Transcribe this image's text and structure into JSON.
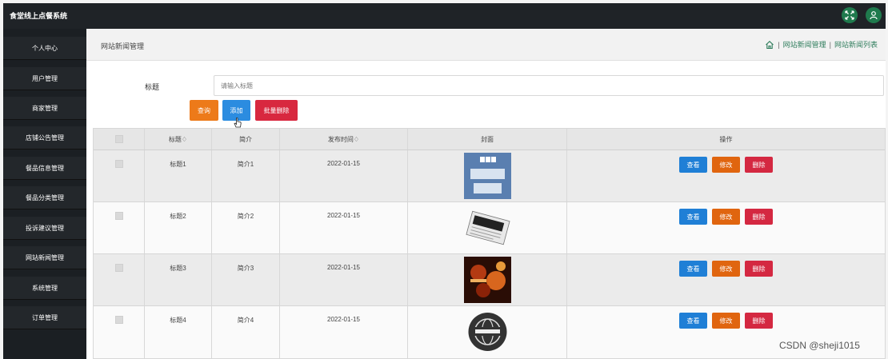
{
  "app": {
    "title": "食堂线上点餐系统"
  },
  "sidebar": {
    "items": [
      {
        "label": "个人中心"
      },
      {
        "label": "用户管理"
      },
      {
        "label": "商家管理"
      },
      {
        "label": "店铺公告管理"
      },
      {
        "label": "餐品信息管理"
      },
      {
        "label": "餐品分类管理"
      },
      {
        "label": "投诉建议管理"
      },
      {
        "label": "网站新闻管理"
      },
      {
        "label": "系统管理"
      },
      {
        "label": "订单管理"
      }
    ]
  },
  "header": {
    "page_title": "网站新闻管理",
    "breadcrumb": {
      "sep": "|",
      "item1": "网站新闻管理",
      "item2": "网站新闻列表"
    }
  },
  "search": {
    "label": "标题",
    "placeholder": "请输入标题",
    "query_label": "查询",
    "add_label": "添加",
    "batch_delete_label": "批量删除"
  },
  "table": {
    "headers": {
      "title": "标题♢",
      "intro": "简介",
      "time": "发布时间♢",
      "cover": "封面",
      "ops": "操作"
    },
    "rows": [
      {
        "title": "标题1",
        "intro": "简介1",
        "time": "2022-01-15",
        "cover": "bbc-world-news-cover"
      },
      {
        "title": "标题2",
        "intro": "简介2",
        "time": "2022-01-15",
        "cover": "newspaper-cover"
      },
      {
        "title": "标题3",
        "intro": "简介3",
        "time": "2022-01-15",
        "cover": "news-collage-cover"
      },
      {
        "title": "标题4",
        "intro": "简介4",
        "time": "2022-01-15",
        "cover": "news-globe-cover"
      }
    ],
    "op_view": "查看",
    "op_edit": "修改",
    "op_delete": "删除"
  },
  "watermark": "CSDN @sheji1015",
  "colors": {
    "accent_green": "#2f7d5c",
    "query": "#ed7a19",
    "add": "#2b8ce0",
    "delete": "#d8283f",
    "sidebar": "#1b1f23"
  }
}
